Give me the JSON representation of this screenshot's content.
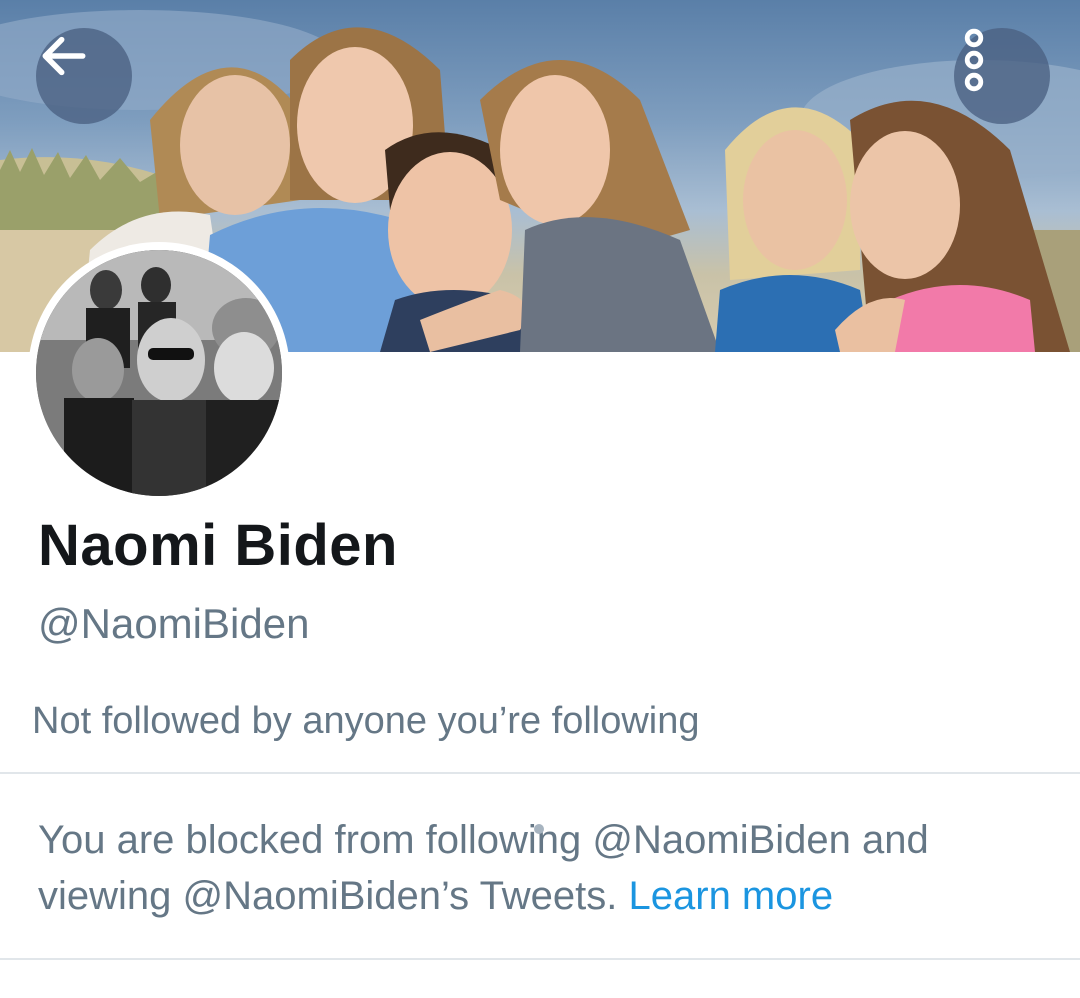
{
  "header": {
    "back_icon": "arrow-left-icon",
    "more_icon": "more-vertical-icon",
    "banner_image": "profile-banner-photo",
    "avatar_image": "profile-avatar-photo"
  },
  "profile": {
    "name": "Naomi Biden",
    "handle": "@NaomiBiden",
    "followed_by": "Not followed by anyone you’re following"
  },
  "blocked_notice": {
    "text": "You are blocked from following @NaomiBiden and viewing @NaomiBiden’s Tweets.",
    "learn_more": "Learn more"
  },
  "colors": {
    "name_text": "#14171a",
    "secondary_text": "#657786",
    "link": "#1b95e0",
    "divider": "#e1e6ea",
    "button_overlay": "#4a6082"
  }
}
